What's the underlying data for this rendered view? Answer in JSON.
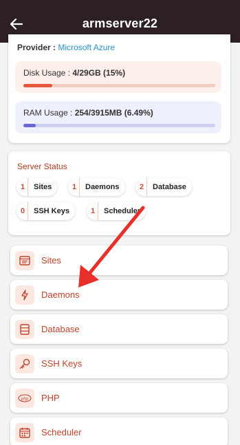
{
  "header": {
    "title": "armserver22",
    "back_icon": "arrow-left-icon"
  },
  "info": {
    "provider_label": "Provider : ",
    "provider_value": "Microsoft Azure",
    "disk": {
      "label_prefix": "Disk Usage : ",
      "value": "4/29GB (15%)",
      "fraction": 0.15
    },
    "ram": {
      "label_prefix": "RAM Usage : ",
      "value": "254/3915MB (6.49%)",
      "fraction": 0.0649
    }
  },
  "status": {
    "title": "Server Status",
    "chips": [
      {
        "count": "1",
        "label": "Sites"
      },
      {
        "count": "1",
        "label": "Daemons"
      },
      {
        "count": "2",
        "label": "Database"
      },
      {
        "count": "0",
        "label": "SSH Keys"
      },
      {
        "count": "1",
        "label": "Scheduler"
      }
    ]
  },
  "menu": [
    {
      "label": "Sites",
      "icon": "sites-icon"
    },
    {
      "label": "Daemons",
      "icon": "lightning-icon"
    },
    {
      "label": "Database",
      "icon": "database-icon"
    },
    {
      "label": "SSH Keys",
      "icon": "key-icon"
    },
    {
      "label": "PHP",
      "icon": "php-icon"
    },
    {
      "label": "Scheduler",
      "icon": "calendar-icon"
    }
  ],
  "colors": {
    "accent": "#c0432b",
    "appbar": "#2c1f25",
    "arrow": "#e8302a"
  }
}
